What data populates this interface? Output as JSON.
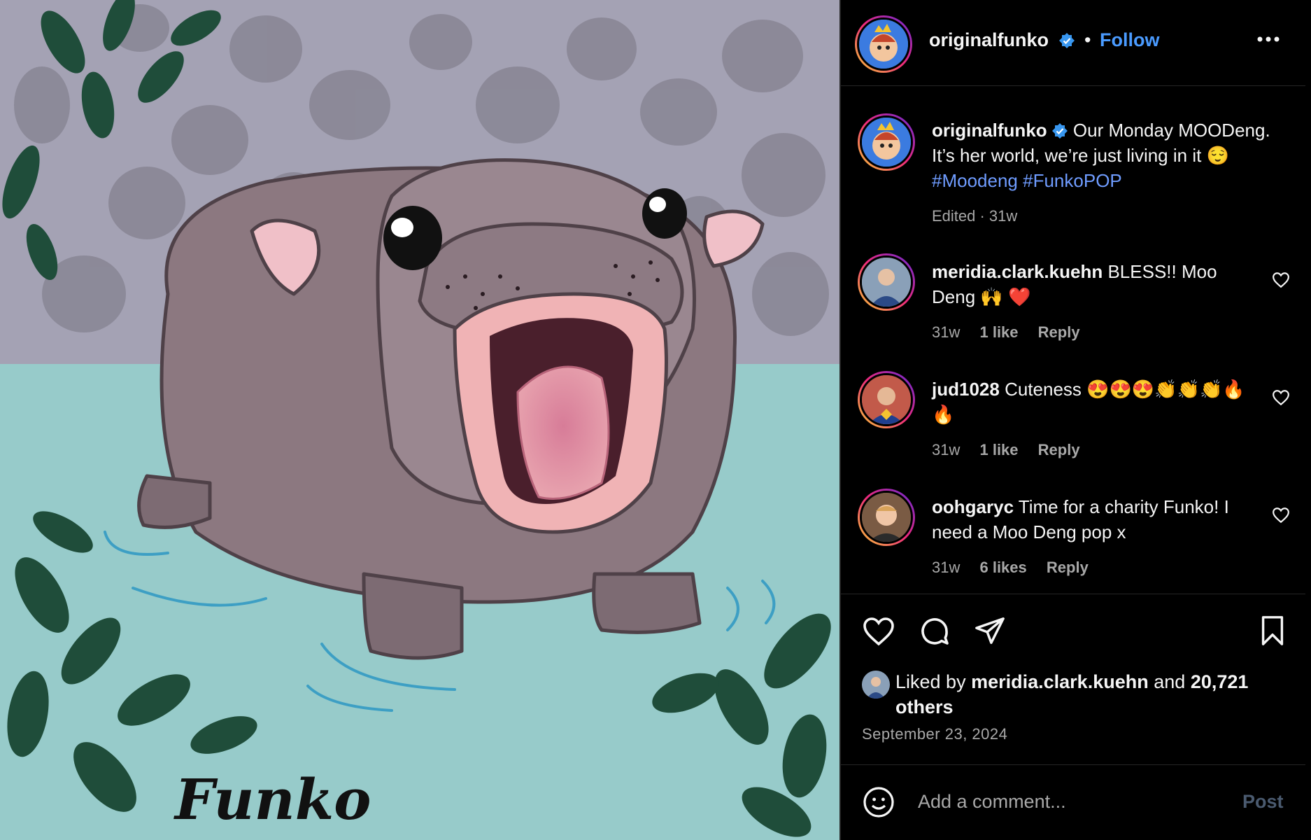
{
  "post": {
    "author": "originalfunko",
    "follow_label": "Follow",
    "separator": "•",
    "image_watermark": "Funko"
  },
  "caption": {
    "user": "originalfunko",
    "text": "Our Monday MOODeng. It’s her world, we’re just living in it 😌",
    "hashtags": [
      "#Moodeng",
      "#FunkoPOP"
    ],
    "meta": "Edited · 31w"
  },
  "comments": [
    {
      "user": "meridia.clark.kuehn",
      "text": "BLESS!! Moo Deng 🙌 ❤️",
      "time": "31w",
      "likes": "1 like",
      "reply": "Reply"
    },
    {
      "user": "jud1028",
      "text": "Cuteness 😍😍😍👏👏👏🔥🔥",
      "time": "31w",
      "likes": "1 like",
      "reply": "Reply"
    },
    {
      "user": "oohgaryc",
      "text": "Time for a charity Funko! I need a Moo Deng pop x",
      "time": "31w",
      "likes": "6 likes",
      "reply": "Reply"
    }
  ],
  "likes": {
    "prefix": "Liked by",
    "user": "meridia.clark.kuehn",
    "middle": "and",
    "count": "20,721 others"
  },
  "date": "September 23, 2024",
  "comment_box": {
    "placeholder": "Add a comment...",
    "post_label": "Post"
  },
  "icons": {
    "more": "more-horizontal-icon",
    "like": "heart-icon",
    "comment": "comment-icon",
    "share": "send-icon",
    "save": "bookmark-icon",
    "emoji": "emoji-icon",
    "verified": "verified-badge-icon"
  },
  "colors": {
    "accent": "#4a9bff",
    "hashtag": "#6f9cff",
    "secondary_text": "#a8a8a8",
    "background": "#000000"
  }
}
